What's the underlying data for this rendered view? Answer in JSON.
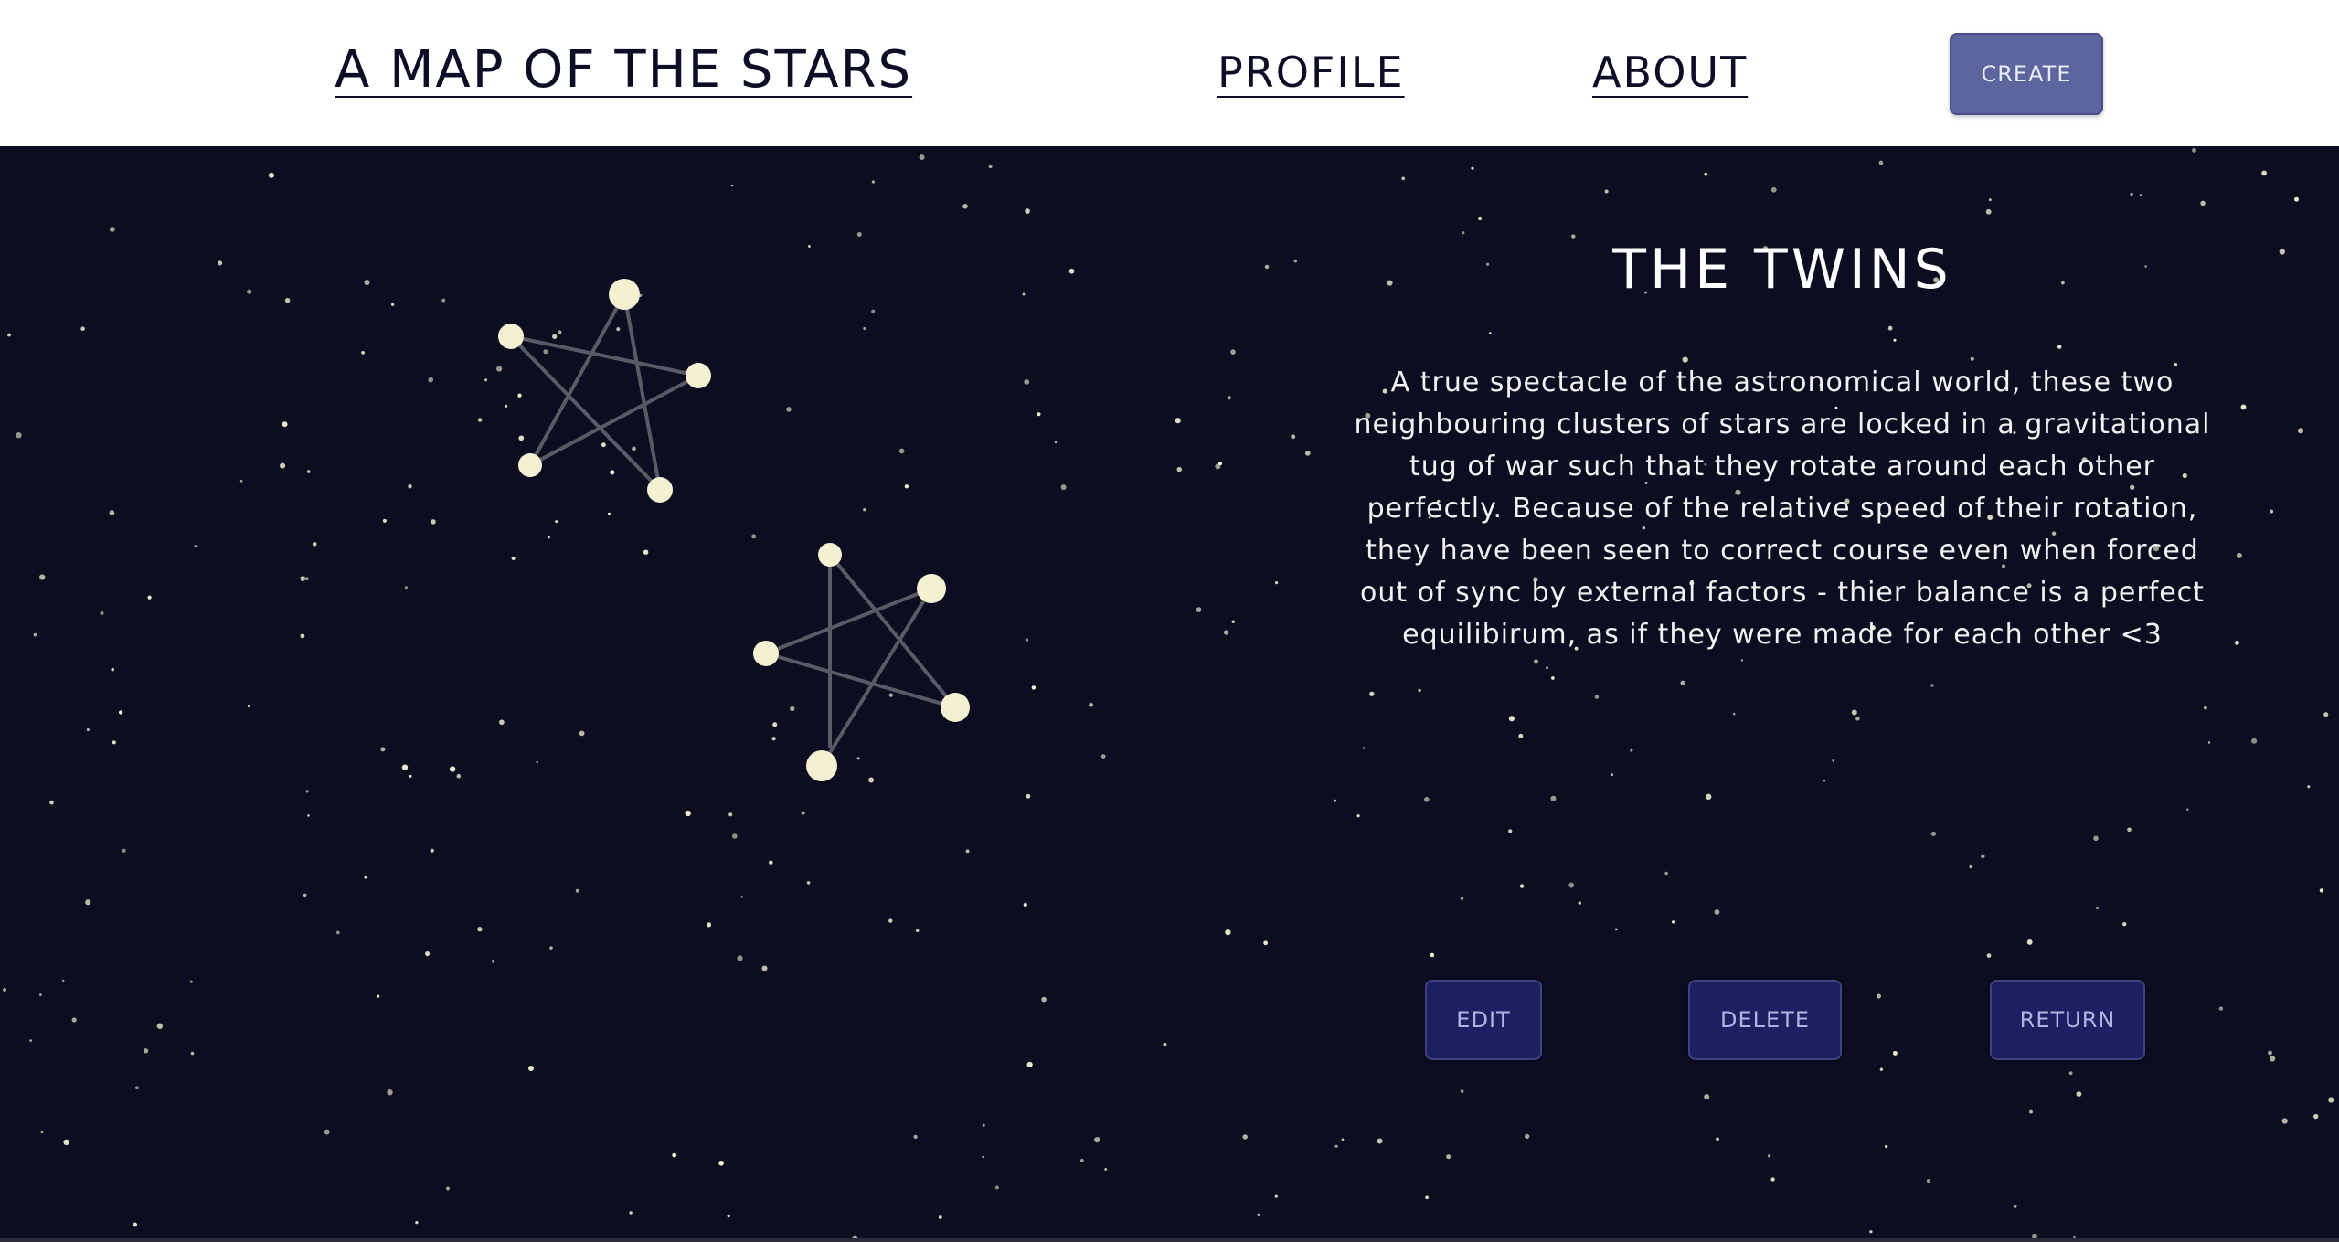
{
  "header": {
    "site_title": "A MAP OF THE STARS",
    "nav": {
      "profile": "PROFILE",
      "about": "ABOUT"
    },
    "create_label": "CREATE"
  },
  "constellation": {
    "title": "THE TWINS",
    "description": "A true spectacle of the astronomical world, these two neighbouring clusters of stars are locked in a gravitational tug of war such that they rotate around each other perfectly. Because of the relative speed of their rotation, they have been seen to correct course even when forced out of sync by external factors - thier balance is a perfect equilibirum, as if they were made for each other <3"
  },
  "actions": {
    "edit": "EDIT",
    "delete": "DELETE",
    "return": "RETURN"
  },
  "colors": {
    "sky": "#0d0d21",
    "star": "#f4f1d2",
    "line": "#5a5a66",
    "create_button": "#5c659e",
    "action_button": "#1b2063"
  }
}
